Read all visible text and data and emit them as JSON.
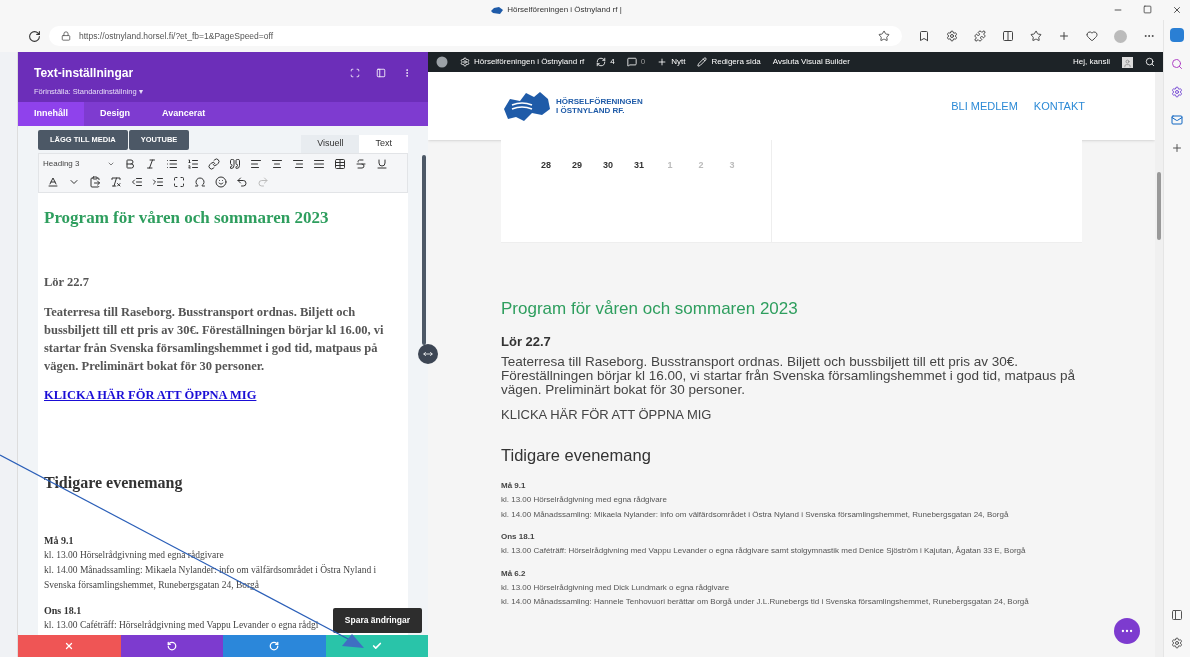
{
  "browser": {
    "tab_title": "Hörselföreningen i Östnyland rf |",
    "url": "https://ostnyland.horsel.fi/?et_fb=1&PageSpeed=off"
  },
  "builder": {
    "title": "Text-inställningar",
    "preset": "Förinställa: Standardinställning",
    "preset_caret": "▾",
    "tabs": [
      {
        "label": "Innehåll",
        "selected": true
      },
      {
        "label": "Design",
        "selected": false
      },
      {
        "label": "Avancerat",
        "selected": false
      }
    ],
    "media_buttons": [
      "LÄGG TILL MEDIA",
      "YOUTUBE"
    ],
    "editor_tabs": [
      {
        "label": "Visuell",
        "selected": false
      },
      {
        "label": "Text",
        "selected": true
      }
    ],
    "format_select": "Heading 3",
    "content": {
      "heading": "Program för våren och sommaren 2023",
      "date": "Lör 22.7",
      "paragraph": "Teaterresa till Raseborg. Busstransport ordnas. Biljett och bussbiljett till ett pris av 30€. Föreställningen börjar kl 16.00, vi startar från Svenska församlingshemmet i god tid, matpaus på vägen. Preliminärt bokat för 30 personer.",
      "link": "KLICKA HÄR FÖR ATT ÖPPNA MIG",
      "section_heading": "Tidigare evenemang",
      "events": [
        {
          "date": "Må 9.1",
          "lines": [
            "kl. 13.00 Hörselrådgivning med egna rådgivare",
            "kl. 14.00 Månadssamling: Mikaela Nylander: info om välfärdsområdet i Östra Nyland i Svenska församlingshemmet, Runebergsgatan 24, Borgå"
          ]
        },
        {
          "date": "Ons 18.1",
          "lines": [
            "kl. 13.00 Caféträff: Hörselrådgivning med Vappu Levander o egna rådgi"
          ]
        }
      ]
    },
    "save_tooltip": "Spara ändringar"
  },
  "site": {
    "admin_bar": {
      "site_name": "Hörselföreningen i Östnyland rf",
      "updates": "4",
      "comments": "0",
      "new": "Nytt",
      "edit": "Redigera sida",
      "exit": "Avsluta Visual Builder",
      "greeting": "Hej, kansli"
    },
    "logo_lines": [
      "HÖRSELFÖRENINGEN",
      "I ÖSTNYLAND RF."
    ],
    "nav": [
      "BLI MEDLEM",
      "KONTAKT"
    ],
    "calendar_days": [
      {
        "label": "28",
        "faded": false
      },
      {
        "label": "29",
        "faded": false
      },
      {
        "label": "30",
        "faded": false
      },
      {
        "label": "31",
        "faded": false
      },
      {
        "label": "1",
        "faded": true
      },
      {
        "label": "2",
        "faded": true
      },
      {
        "label": "3",
        "faded": true
      }
    ],
    "content": {
      "heading": "Program för våren och sommaren 2023",
      "date": "Lör 22.7",
      "paragraph": "Teaterresa till Raseborg. Busstransport ordnas. Biljett och bussbiljett till ett pris av 30€. Föreställningen börjar kl 16.00, vi startar från Svenska församlingshemmet i god tid, matpaus på vägen. Preliminärt bokat för 30 personer.",
      "link": "KLICKA HÄR FÖR ATT ÖPPNA MIG",
      "section_heading": "Tidigare evenemang",
      "events": [
        {
          "date": "Må 9.1",
          "lines": [
            "kl. 13.00 Hörselrådgivning med egna rådgivare",
            "kl. 14.00 Månadssamling: Mikaela Nylander: info om välfärdsområdet i Östra Nyland i Svenska församlingshemmet, Runebergsgatan 24, Borgå"
          ]
        },
        {
          "date": "Ons 18.1",
          "lines": [
            "kl. 13.00 Caféträff: Hörselrådgivning med Vappu Levander o egna rådgivare samt stolgymnastik med Denice Sjöström i Kajutan, Ågatan 33 E, Borgå"
          ]
        },
        {
          "date": "Må 6.2",
          "lines": [
            "kl. 13.00 Hörselrådgivning med Dick Lundmark o egna rådgivare",
            "kl. 14.00 Månadssamling: Hannele Tenhovuori berättar om Borgå under J.L.Runebergs tid i Svenska församlingshemmet, Runebergsgatan 24, Borgå"
          ]
        }
      ]
    }
  }
}
